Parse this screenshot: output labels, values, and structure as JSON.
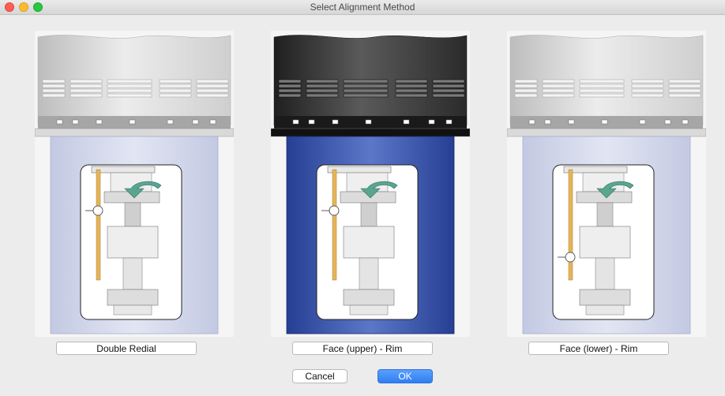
{
  "window": {
    "title": "Select Alignment Method"
  },
  "methods": [
    {
      "label": "Double Redial",
      "selected": false
    },
    {
      "label": "Face (upper) - Rim",
      "selected": true
    },
    {
      "label": "Face (lower) - Rim",
      "selected": false
    }
  ],
  "buttons": {
    "cancel": "Cancel",
    "ok": "OK"
  },
  "colors": {
    "accent": "#2f7ff3",
    "selected_body": "#263f94",
    "unselected_body": "#c3c9e2",
    "arrow": "#5aa590",
    "indicator": "#e6b45a"
  },
  "icons": {
    "card_graphic": "machine-alignment-diagram",
    "rotation": "rotation-arrow-icon",
    "dial": "dial-indicator-icon"
  }
}
